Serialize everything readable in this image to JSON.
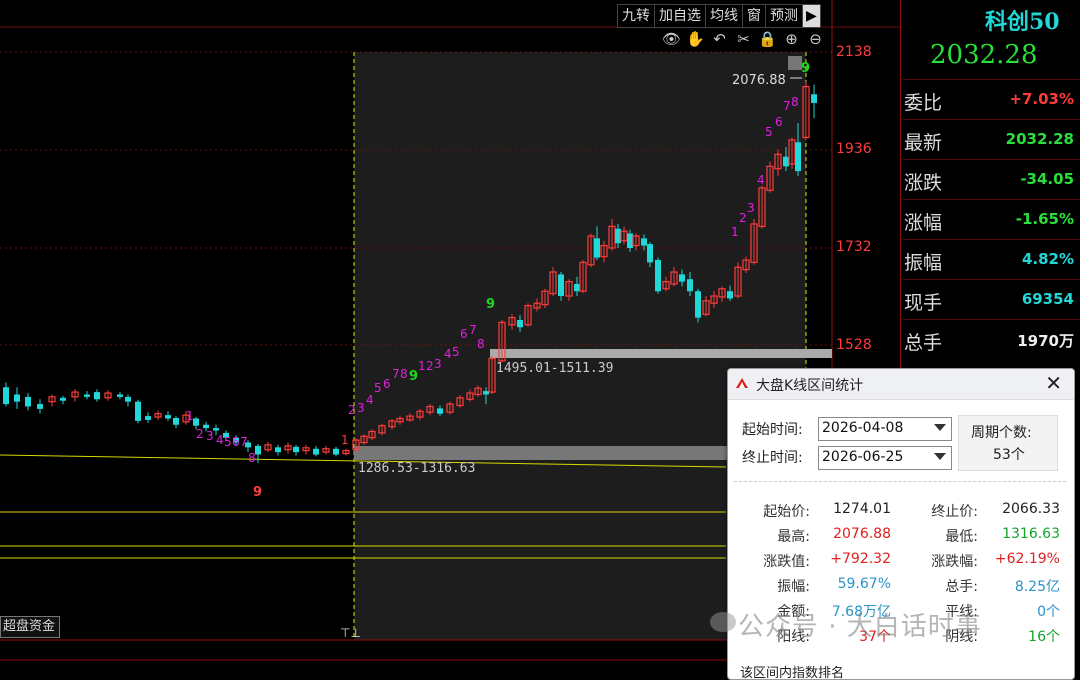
{
  "toolbar": {
    "buttons": [
      "九转",
      "加自选",
      "均线",
      "窗",
      "预测"
    ],
    "play_icon": "play-icon"
  },
  "chart_icons": [
    "eye-icon",
    "hand-icon",
    "undo-icon",
    "scissors-icon",
    "lock-icon",
    "zoom-in-icon",
    "zoom-out-icon"
  ],
  "price_axis": [
    "2138",
    "1936",
    "1732",
    "1528"
  ],
  "annotations": {
    "peak": "2076.88",
    "zone_upper": "1495.01-1511.39",
    "zone_lower": "1286.53-1316.63"
  },
  "chart_data": {
    "type": "candlestick",
    "y_axis_ticks": [
      2138,
      1936,
      1732,
      1528
    ],
    "selection_range": [
      "2026-04-08",
      "2026-06-25"
    ],
    "high": 2076.88,
    "low": 1316.63,
    "start": 1274.01,
    "end": 2066.33,
    "nine_turn_counts_before": [
      "1",
      "2",
      "3",
      "4",
      "5",
      "6",
      "7",
      "8",
      "9"
    ],
    "nine_turn_counts_after": [
      "1",
      "2",
      "3",
      "4",
      "5",
      "6",
      "7",
      "8",
      "9"
    ],
    "colors": {
      "up": "#ff3c3c",
      "down": "#21d8d8",
      "count_magenta": "#e020e0",
      "count_red": "#ff3c3c",
      "count_green": "#1ed81e"
    }
  },
  "bottom_tab": "超盘资金",
  "right_panel": {
    "title": "科创50",
    "price": "2032.28",
    "rows": [
      {
        "label": "委比",
        "value": "+7.03%",
        "color": "red"
      },
      {
        "label": "最新",
        "value": "2032.28",
        "color": "green"
      },
      {
        "label": "涨跌",
        "value": "-34.05",
        "color": "green"
      },
      {
        "label": "涨幅",
        "value": "-1.65%",
        "color": "green"
      },
      {
        "label": "振幅",
        "value": "4.82%",
        "color": "cyan"
      },
      {
        "label": "现手",
        "value": "69354",
        "color": "cyan"
      },
      {
        "label": "总手",
        "value": "1970万",
        "color": "white"
      }
    ]
  },
  "dialog": {
    "title": "大盘K线区间统计",
    "start_label": "起始时间:",
    "start_value": "2026-04-08",
    "end_label": "终止时间:",
    "end_value": "2026-06-25",
    "period_label": "周期个数:",
    "period_value": "53个",
    "stats": [
      {
        "l1": "起始价:",
        "v1": "1274.01",
        "c1": "dark",
        "l2": "终止价:",
        "v2": "2066.33",
        "c2": "dark"
      },
      {
        "l1": "最高:",
        "v1": "2076.88",
        "c1": "red",
        "l2": "最低:",
        "v2": "1316.63",
        "c2": "green"
      },
      {
        "l1": "涨跌值:",
        "v1": "+792.32",
        "c1": "red",
        "l2": "涨跌幅:",
        "v2": "+62.19%",
        "c2": "red"
      },
      {
        "l1": "振幅:",
        "v1": "59.67%",
        "c1": "blue",
        "l2": "总手:",
        "v2": "8.25亿",
        "c2": "blue"
      },
      {
        "l1": "金额:",
        "v1": "7.68万亿",
        "c1": "blue",
        "l2": "平线:",
        "v2": "0个",
        "c2": "blue"
      },
      {
        "l1": "阳线:",
        "v1": "37个",
        "c1": "red",
        "l2": "阴线:",
        "v2": "16个",
        "c2": "green"
      }
    ],
    "footer": "该区间内指数排名"
  },
  "watermark": "公众号 · 大白话时事"
}
